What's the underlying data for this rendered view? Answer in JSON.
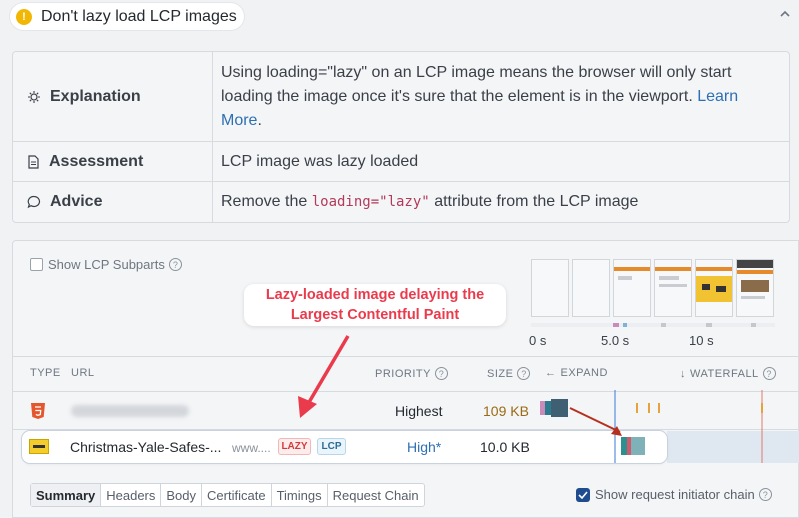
{
  "header": {
    "title": "Don't lazy load LCP images",
    "warn_icon": "warning-icon",
    "collapse_icon": "chevron-up-icon"
  },
  "info": {
    "explanation_label": "Explanation",
    "explanation_text_1": "Using loading=\"lazy\" on an LCP image means the browser will only start",
    "explanation_text_2": "loading the image once it's sure that the element is in the viewport.",
    "learn_more_1": "Learn",
    "learn_more_2": "More",
    "period": ".",
    "assessment_label": "Assessment",
    "assessment_text": "LCP image was lazy loaded",
    "advice_label": "Advice",
    "advice_prefix": "Remove the",
    "advice_code": "loading=\"lazy\"",
    "advice_suffix": "attribute from the LCP image"
  },
  "panel": {
    "subparts_label": "Show LCP Subparts",
    "help": "?",
    "time_labels": [
      "0 s",
      "5.0 s",
      "10 s"
    ],
    "columns": {
      "type": "TYPE",
      "url": "URL",
      "priority": "PRIORITY",
      "size": "SIZE",
      "expand": "EXPAND",
      "waterfall": "WATERFALL"
    },
    "row1": {
      "priority": "Highest",
      "size": "109 KB"
    },
    "selected_row": {
      "filename": "Christmas-Yale-Safes-...",
      "host": "www....",
      "tag_lazy": "LAZY",
      "tag_lcp": "LCP",
      "priority": "High*",
      "size": "10.0 KB"
    },
    "tabs": [
      "Summary",
      "Headers",
      "Body",
      "Certificate",
      "Timings",
      "Request Chain"
    ],
    "initiator_label": "Show request initiator chain"
  },
  "callout": {
    "line1": "Lazy-loaded image delaying the",
    "line2": "Largest Contentful Paint"
  },
  "colors": {
    "accent_red": "#ea3b4d",
    "link_blue": "#2d6fb3",
    "size_brown": "#9a6b12"
  }
}
